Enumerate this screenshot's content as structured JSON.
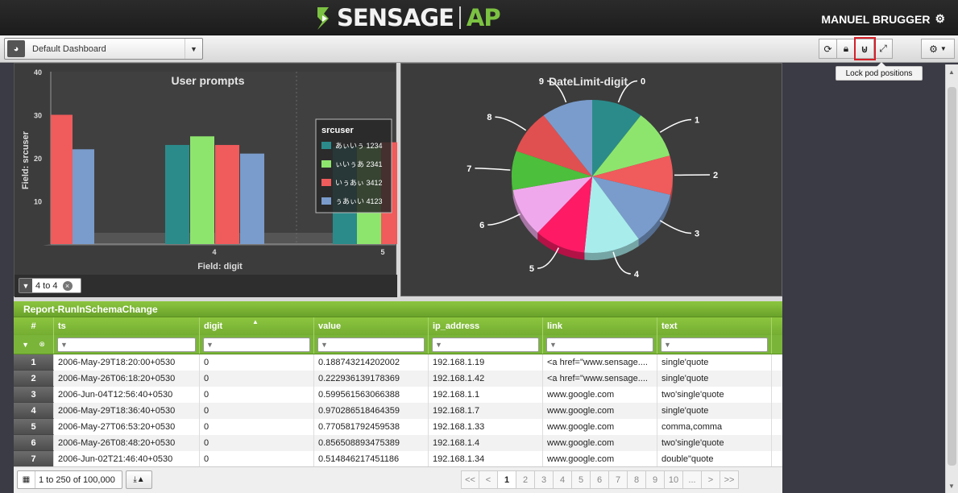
{
  "header": {
    "brand": "SENSAGE",
    "product": "AP",
    "user": "MANUEL BRUGGER"
  },
  "toolbar": {
    "dashboard": "Default Dashboard",
    "tooltip": "Lock pod positions"
  },
  "bar_pod": {
    "title": "User prompts",
    "ylabel": "Field: srcuser",
    "xlabel": "Field: digit",
    "yticks": [
      "40",
      "30",
      "20",
      "10"
    ],
    "xticks": [
      "4",
      "5"
    ],
    "legend_title": "srcuser",
    "legend": [
      "あぃいぅ 1234",
      "ぃいぅあ 2341",
      "いぅあぃ 3412",
      "ぅあぃい 4123"
    ],
    "filter": "4 to 4"
  },
  "pie_pod": {
    "title": "DateLimit-digit",
    "labels": [
      "0",
      "1",
      "2",
      "3",
      "4",
      "5",
      "6",
      "7",
      "8",
      "9"
    ]
  },
  "chart_data": [
    {
      "type": "bar",
      "title": "User prompts",
      "xlabel": "Field: digit",
      "ylabel": "Field: srcuser",
      "categories": [
        "4",
        "5"
      ],
      "series": [
        {
          "name": "あぃいぅ 1234",
          "values": [
            23,
            23
          ]
        },
        {
          "name": "ぃいぅあ 2341",
          "values": [
            25,
            23
          ]
        },
        {
          "name": "いぅあぃ 3412",
          "values": [
            23,
            24
          ]
        },
        {
          "name": "ぅあぃい 4123",
          "values": [
            21,
            22
          ]
        }
      ],
      "partial_left": [
        30,
        22
      ],
      "ylim": [
        0,
        40
      ],
      "colors": [
        "#2b8b8b",
        "#8ee56e",
        "#f05b5b",
        "#7a9ccc"
      ]
    },
    {
      "type": "pie",
      "title": "DateLimit-digit",
      "categories": [
        "0",
        "1",
        "2",
        "3",
        "4",
        "5",
        "6",
        "7",
        "8",
        "9"
      ],
      "values": [
        10,
        10,
        8,
        11,
        11,
        10,
        10,
        8,
        9,
        10
      ],
      "colors": [
        "#2b8b8b",
        "#8ee56e",
        "#f05b5b",
        "#7a9ccc",
        "#a8ecec",
        "#ff1a66",
        "#f0a8ec",
        "#4cbf3c",
        "#e05050",
        "#7a9ccc"
      ]
    }
  ],
  "table": {
    "title": "Report-RunInSchemaChange",
    "columns": [
      "#",
      "ts",
      "digit",
      "value",
      "ip_address",
      "link",
      "text"
    ],
    "rows": [
      [
        "1",
        "2006-May-29T18:20:00+0530",
        "0",
        "0.188743214202002",
        "192.168.1.19",
        "<a href=\"www.sensage....",
        "single'quote"
      ],
      [
        "2",
        "2006-May-26T06:18:20+0530",
        "0",
        "0.222936139178369",
        "192.168.1.42",
        "<a href=\"www.sensage....",
        "single'quote"
      ],
      [
        "3",
        "2006-Jun-04T12:56:40+0530",
        "0",
        "0.599561563066388",
        "192.168.1.1",
        "www.google.com",
        "two'single'quote"
      ],
      [
        "4",
        "2006-May-29T18:36:40+0530",
        "0",
        "0.970286518464359",
        "192.168.1.7",
        "www.google.com",
        "single'quote"
      ],
      [
        "5",
        "2006-May-27T06:53:20+0530",
        "0",
        "0.770581792459538",
        "192.168.1.33",
        "www.google.com",
        "comma,comma"
      ],
      [
        "6",
        "2006-May-26T08:48:20+0530",
        "0",
        "0.856508893475389",
        "192.168.1.4",
        "www.google.com",
        "two'single'quote"
      ],
      [
        "7",
        "2006-Jun-02T21:46:40+0530",
        "0",
        "0.514846217451186",
        "192.168.1.34",
        "www.google.com",
        "double\"quote"
      ]
    ]
  },
  "pager": {
    "info": "1 to 250 of 100,000",
    "buttons": [
      "<<",
      "<",
      "1",
      "2",
      "3",
      "4",
      "5",
      "6",
      "7",
      "8",
      "9",
      "10",
      "...",
      ">",
      ">>"
    ],
    "active": "1"
  }
}
